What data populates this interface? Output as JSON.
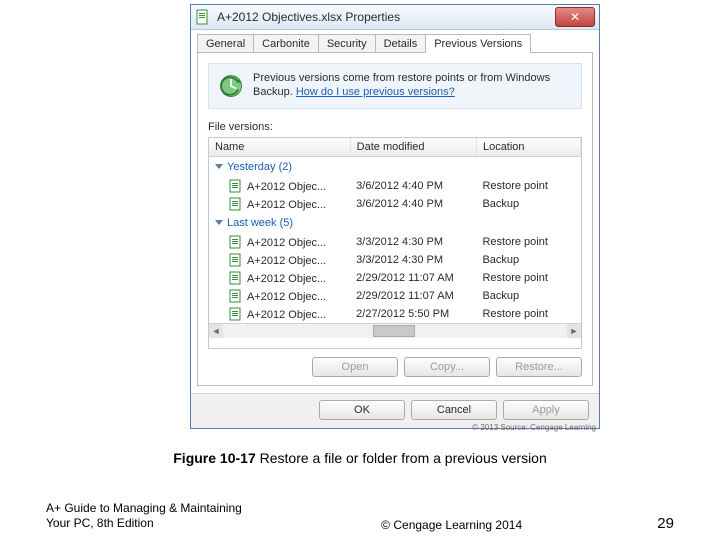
{
  "titlebar": {
    "title": "A+2012 Objectives.xlsx Properties"
  },
  "tabs": [
    "General",
    "Carbonite",
    "Security",
    "Details",
    "Previous Versions"
  ],
  "active_tab": 4,
  "info": {
    "text": "Previous versions come from restore points or from Windows Backup. ",
    "link": "How do I use previous versions?"
  },
  "file_versions_label": "File versions:",
  "columns": [
    "Name",
    "Date modified",
    "Location"
  ],
  "groups": [
    {
      "label": "Yesterday (2)",
      "items": [
        {
          "name": "A+2012 Objec...",
          "date": "3/6/2012 4:40 PM",
          "loc": "Restore point"
        },
        {
          "name": "A+2012 Objec...",
          "date": "3/6/2012 4:40 PM",
          "loc": "Backup"
        }
      ]
    },
    {
      "label": "Last week (5)",
      "items": [
        {
          "name": "A+2012 Objec...",
          "date": "3/3/2012 4:30 PM",
          "loc": "Restore point"
        },
        {
          "name": "A+2012 Objec...",
          "date": "3/3/2012 4:30 PM",
          "loc": "Backup"
        },
        {
          "name": "A+2012 Objec...",
          "date": "2/29/2012 11:07 AM",
          "loc": "Restore point"
        },
        {
          "name": "A+2012 Objec...",
          "date": "2/29/2012 11:07 AM",
          "loc": "Backup"
        },
        {
          "name": "A+2012 Objec...",
          "date": "2/27/2012 5:50 PM",
          "loc": "Restore point"
        }
      ]
    }
  ],
  "actions": {
    "open": "Open",
    "copy": "Copy...",
    "restore": "Restore..."
  },
  "dlgbtns": {
    "ok": "OK",
    "cancel": "Cancel",
    "apply": "Apply"
  },
  "image_credit": "© 2013 Source: Cengage Learning",
  "caption": {
    "bold": "Figure 10-17",
    "rest": "  Restore a file or folder from a previous version"
  },
  "footer": {
    "book": "A+ Guide to Managing & Maintaining Your PC, 8th Edition",
    "copy": "© Cengage Learning  2014",
    "page": "29"
  }
}
